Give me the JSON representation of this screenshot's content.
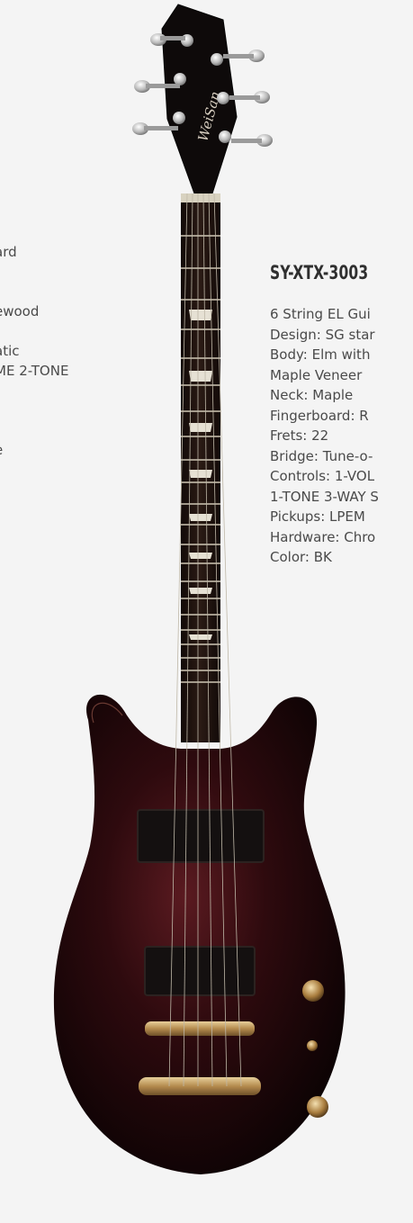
{
  "left_column": {
    "lines": [
      "-",
      "ard",
      "",
      "",
      "ewood",
      "",
      "atic",
      "ME 2-TONE",
      "",
      "",
      "",
      "e"
    ]
  },
  "product": {
    "title": "SY-XTX-3003",
    "specs": [
      "6 String EL Gui",
      "Design: SG star",
      "Body: Elm with",
      "Maple Veneer",
      "Neck: Maple",
      "Fingerboard: R",
      "Frets: 22",
      "Bridge: Tune-o-",
      "Controls: 1-VOL",
      "1-TONE 3-WAY S",
      "Pickups: LPEM",
      "Hardware: Chro",
      "Color: BK"
    ]
  },
  "image": {
    "headstock_logo": "WeiSan",
    "body_color": "#1a0608",
    "hardware_color": "#c9a56a"
  }
}
